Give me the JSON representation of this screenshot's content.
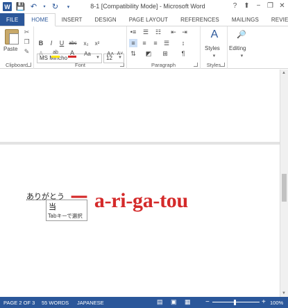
{
  "window": {
    "title": "8-1 [Compatibility Mode] - Microsoft Word",
    "help": "?",
    "minimize": "−",
    "restore": "❐",
    "close": "✕"
  },
  "tabs": [
    "FILE",
    "HOME",
    "INSERT",
    "DESIGN",
    "PAGE LAYOUT",
    "REFERENCES",
    "MAILINGS",
    "REVIEW"
  ],
  "ribbon": {
    "paste_label": "Paste",
    "font_name": "MS Mincho",
    "font_size": "12",
    "styles_label": "Styles",
    "editing_label": "Editing",
    "groups": {
      "clipboard": "Clipboard",
      "font": "Font",
      "paragraph": "Paragraph",
      "styles": "Styles"
    },
    "format_buttons": {
      "bold": "B",
      "italic": "I",
      "underline": "U",
      "strike": "abc",
      "subscript": "x₂",
      "superscript": "x²",
      "grow_font": "A˄",
      "shrink_font": "A˅",
      "change_case": "Aa",
      "font_color": "A",
      "text_effects": "A",
      "highlight": "ab"
    }
  },
  "document": {
    "typed_text": "ありがとう",
    "annotation": "＝ a-ri-ga-tou",
    "ime": {
      "candidate": "当",
      "hint": "Tabキーで選択"
    }
  },
  "status": {
    "page": "PAGE 2 OF 3",
    "words": "55 WORDS",
    "language": "JAPANESE",
    "zoom": "100%",
    "zoom_minus": "−",
    "zoom_plus": "+"
  },
  "colors": {
    "accent": "#2b579a",
    "annotation_red": "#d42a2a"
  }
}
